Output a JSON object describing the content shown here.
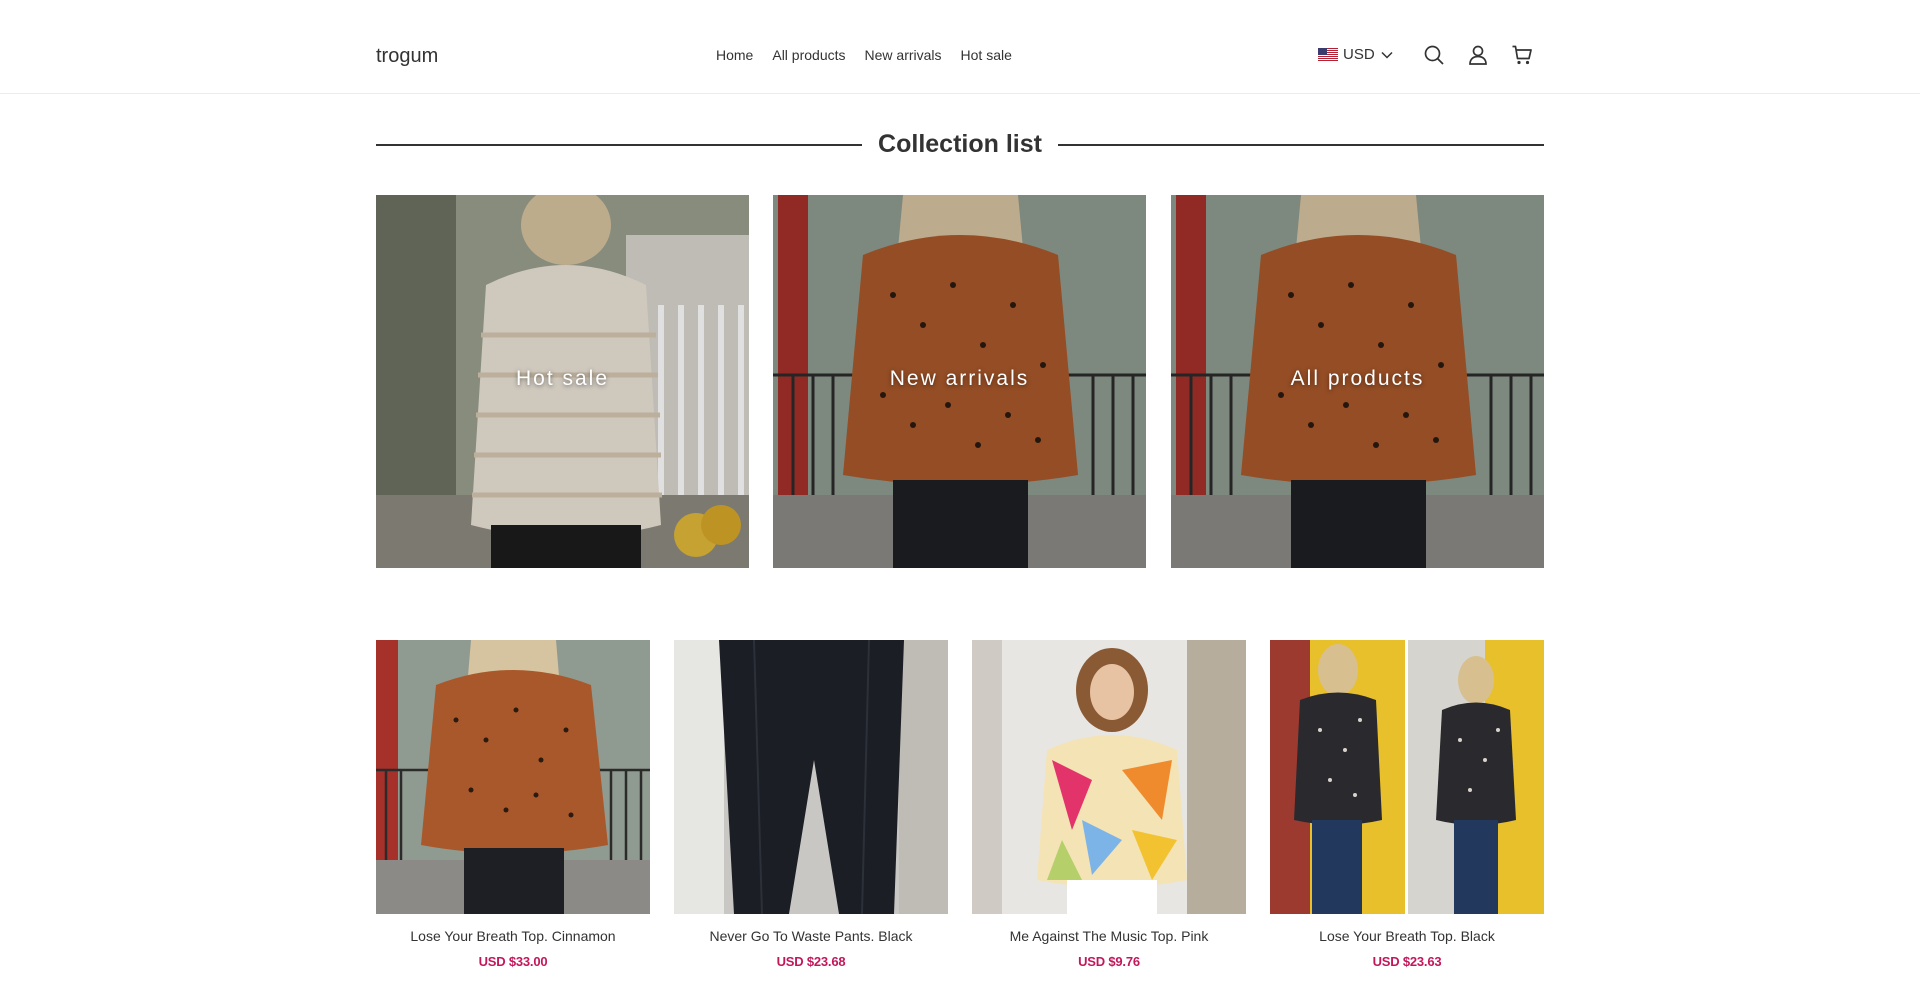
{
  "header": {
    "logo": "trogum",
    "nav": [
      "Home",
      "All products",
      "New arrivals",
      "Hot sale"
    ],
    "currency": "USD",
    "icons": [
      "us-flag-icon",
      "chevron-down-icon",
      "search-icon",
      "account-icon",
      "cart-icon"
    ]
  },
  "section": {
    "title": "Collection list"
  },
  "collections": [
    {
      "label": "Hot sale"
    },
    {
      "label": "New arrivals"
    },
    {
      "label": "All products"
    }
  ],
  "products": [
    {
      "name": "Lose Your Breath Top. Cinnamon",
      "price": "USD $33.00"
    },
    {
      "name": "Never Go To Waste Pants. Black",
      "price": "USD $23.68"
    },
    {
      "name": "Me Against The Music Top. Pink",
      "price": "USD $9.76"
    },
    {
      "name": "Lose Your Breath Top. Black",
      "price": "USD $23.63"
    }
  ],
  "colors": {
    "price": "#c2185b",
    "text": "#333333",
    "divider": "#ececec"
  }
}
